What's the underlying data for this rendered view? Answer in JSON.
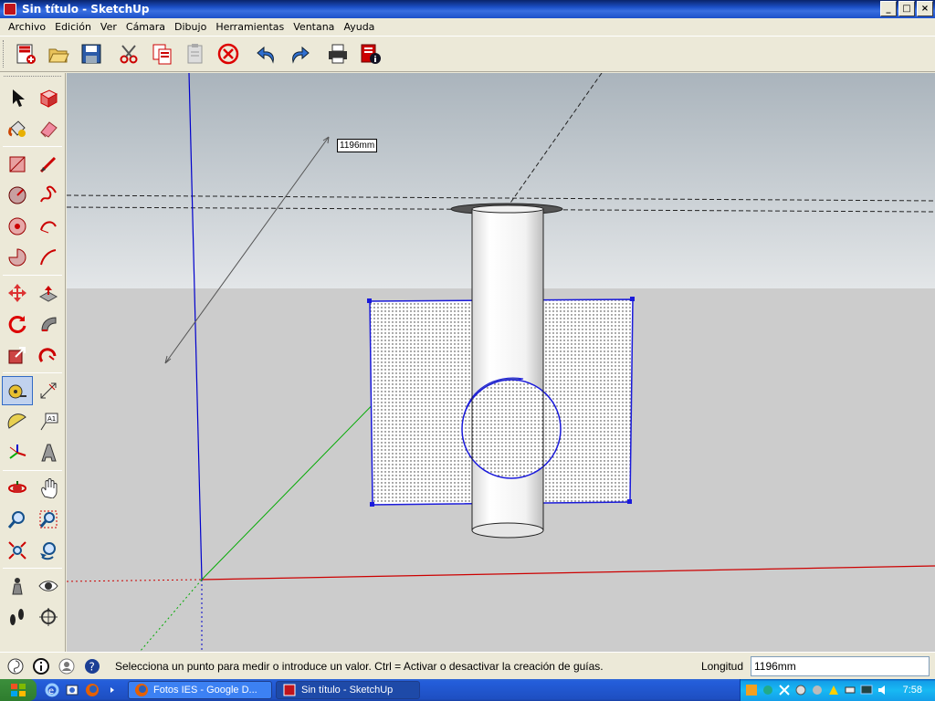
{
  "window": {
    "title": "Sin título - SketchUp"
  },
  "menu": [
    "Archivo",
    "Edición",
    "Ver",
    "Cámara",
    "Dibujo",
    "Herramientas",
    "Ventana",
    "Ayuda"
  ],
  "toolbar": [
    "new-icon",
    "open-icon",
    "save-icon",
    "cut-icon",
    "copy-icon",
    "paste-icon",
    "erase-icon",
    "undo-icon",
    "redo-icon",
    "print-icon",
    "model-info-icon"
  ],
  "palette": [
    [
      "select-icon",
      "make-component-icon"
    ],
    [
      "paint-bucket-icon",
      "eraser-icon"
    ],
    [
      "rectangle-icon",
      "line-icon"
    ],
    [
      "circle-icon",
      "freehand-icon"
    ],
    [
      "polygon-icon",
      "arc-icon"
    ],
    [
      "pie-icon",
      "arc-2point-icon"
    ],
    [
      "move-icon",
      "push-pull-icon"
    ],
    [
      "rotate-icon",
      "follow-me-icon"
    ],
    [
      "scale-icon",
      "offset-icon"
    ],
    [
      "tape-measure-icon",
      "dimension-icon"
    ],
    [
      "protractor-icon",
      "text-icon"
    ],
    [
      "axes-icon",
      "3d-text-icon"
    ],
    [
      "orbit-icon",
      "pan-icon"
    ],
    [
      "zoom-icon",
      "zoom-window-icon"
    ],
    [
      "zoom-extents-icon",
      "previous-view-icon"
    ],
    [
      "position-camera-icon",
      "look-around-icon"
    ],
    [
      "walk-icon",
      "section-plane-icon"
    ]
  ],
  "viewport": {
    "dimension_tag": "1196mm"
  },
  "status": {
    "message": "Selecciona un punto para medir o introduce un valor. Ctrl = Activar o desactivar la creación de guías.",
    "vcb_label": "Longitud",
    "vcb_value": "1196mm"
  },
  "taskbar": {
    "tasks": [
      {
        "label": "Fotos IES - Google D..."
      },
      {
        "label": "Sin título - SketchUp"
      }
    ],
    "clock": "7:58"
  },
  "colors": {
    "accent": "#316ac5",
    "titlebar": "#0a246a",
    "axis_red": "#cc0000",
    "axis_green": "#00aa00",
    "axis_blue": "#0000cc"
  }
}
